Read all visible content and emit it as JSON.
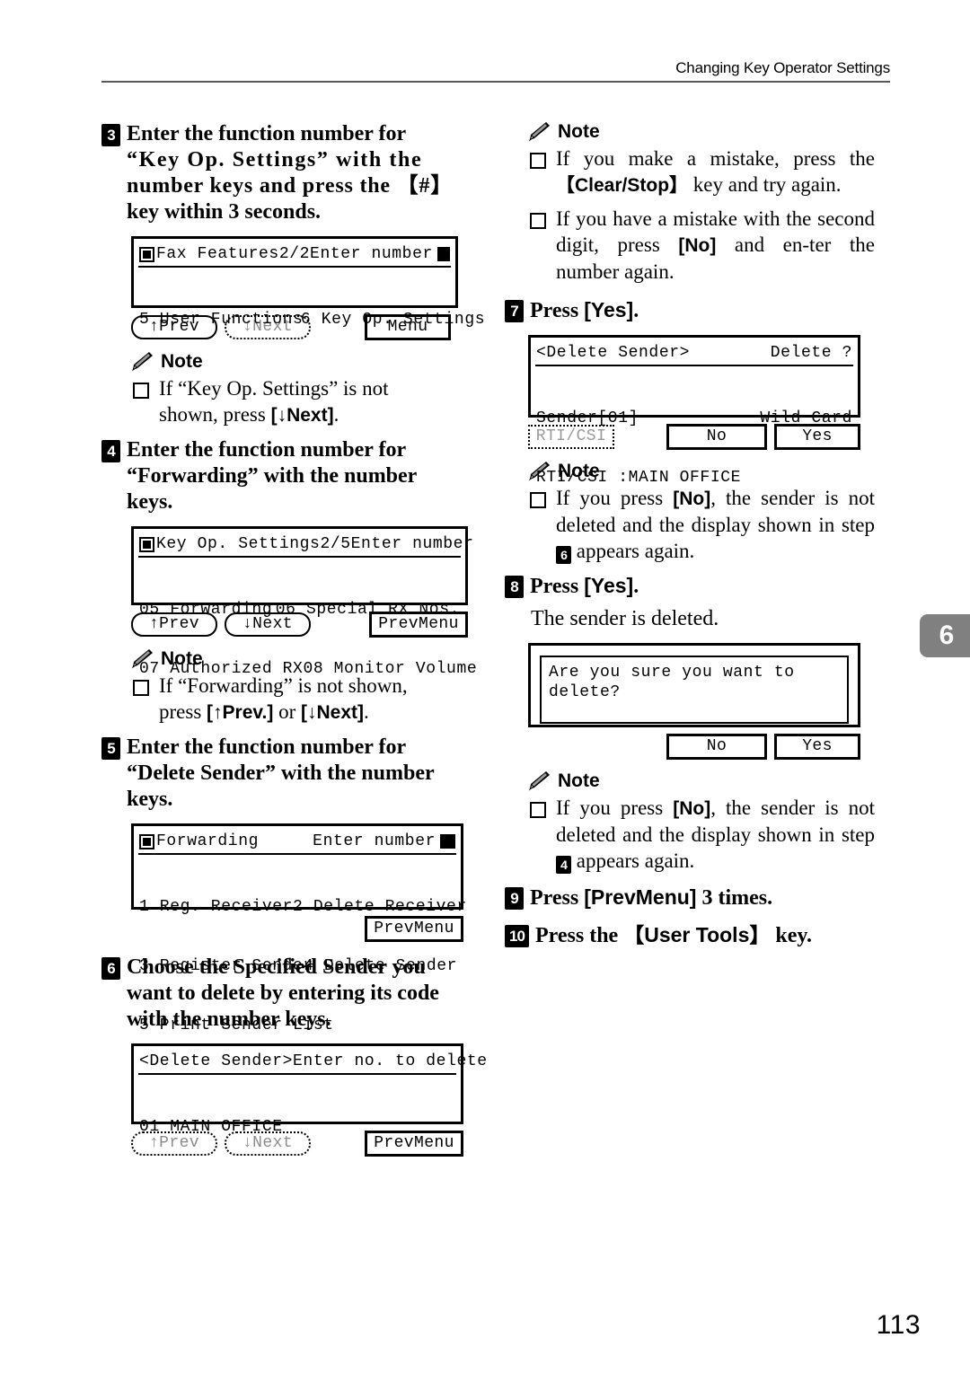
{
  "header": {
    "title": "Changing Key Operator Settings"
  },
  "chapter_tab": "6",
  "page_number": "113",
  "left_column": {
    "step3": {
      "badge": "3",
      "line1": "Enter  the  function  number  for",
      "line2": "“Key Op. Settings” with the",
      "line3": "number keys and press the 【#】",
      "line4": "key within 3 seconds."
    },
    "lcd1": {
      "title_left": "Fax Features",
      "title_mid": "2/2",
      "title_right": "Enter number",
      "row1_col1": "5 User Functions",
      "row1_col2": "6 Key Op. Settings",
      "btn_prev": "↑Prev",
      "btn_next": "↓Next",
      "btn_menu": "Menu"
    },
    "note1": {
      "label": "Note",
      "line1": "If  “Key  Op.  Settings”  is  not",
      "line2_pre": "shown, press ",
      "line2_key": "[↓Next]",
      "line2_post": "."
    },
    "step4": {
      "badge": "4",
      "line1": "Enter  the  function  number  for",
      "line2": "“Forwarding” with the number",
      "line3": "keys."
    },
    "lcd2": {
      "title_left": "Key Op. Settings",
      "title_mid": "2/5",
      "title_right": "Enter number",
      "row1_col1": "05 Forwarding",
      "row1_col2": "06 Special RX Nos.",
      "row2_col1": "07 Authorized RX",
      "row2_col2": "08 Monitor Volume",
      "btn_prev": "↑Prev",
      "btn_next": "↓Next",
      "btn_prevmenu": "PrevMenu"
    },
    "note2": {
      "label": "Note",
      "line1": "If  “Forwarding”  is  not  shown,",
      "line2_pre": "press ",
      "line2_key1": "[↑Prev.]",
      "line2_mid": " or ",
      "line2_key2": "[↓Next]",
      "line2_post": "."
    },
    "step5": {
      "badge": "5",
      "line1": "Enter  the  function  number  for",
      "line2": "“Delete Sender” with the number",
      "line3": "keys."
    },
    "lcd3": {
      "title_left": "Forwarding",
      "title_right": "Enter number",
      "row1_col1": "1 Reg. Receiver",
      "row1_col2": "2 Delete Receiver",
      "row2_col1": "3 Register Sender",
      "row2_col2": "4 Delete Sender",
      "row3_col1": "5 Print Sender List",
      "btn_prevmenu": "PrevMenu"
    },
    "step6": {
      "badge": "6",
      "line1": "Choose the Specified Sender you",
      "line2": "want to delete by entering its code",
      "line3": "with the number keys."
    },
    "lcd4": {
      "title_left": "<Delete Sender>",
      "title_right": "Enter no. to delete",
      "row1_col1": "01 MAIN OFFICE",
      "btn_prev": "↑Prev",
      "btn_next": "↓Next",
      "btn_prevmenu": "PrevMenu"
    }
  },
  "right_column": {
    "note3": {
      "label": "Note",
      "item1_pre": "If you make a mistake, press the",
      "item1_key": "【Clear/Stop】",
      "item1_post": " key and try again.",
      "item2_pre": "If  you  have  a  mistake  with  the second digit, press ",
      "item2_key": "[No]",
      "item2_post": " and en-ter the number again."
    },
    "step7": {
      "badge": "7",
      "text_pre": "Press ",
      "text_key": "[Yes]",
      "text_post": "."
    },
    "lcd5": {
      "title_left": "<Delete Sender>",
      "title_right": "Delete ?",
      "row1_col1": "Sender[01]",
      "row1_col2": "Wild Card",
      "row2_col1": "RTI/CSI :MAIN OFFICE",
      "btn_rticsi": "RTI/CSI",
      "btn_no": "No",
      "btn_yes": "Yes"
    },
    "note4": {
      "label": "Note",
      "item1_pre": "If you press ",
      "item1_key": "[No]",
      "item1_mid": ", the sender is not  deleted  and  the  display shown in step ",
      "item1_badge": "6",
      "item1_post": " appears again."
    },
    "step8": {
      "badge": "8",
      "text_pre": "Press ",
      "text_key": "[Yes]",
      "text_post": ".",
      "sub": "The sender is deleted."
    },
    "lcd6": {
      "message": "Are you sure you want to delete?",
      "btn_no": "No",
      "btn_yes": "Yes"
    },
    "note5": {
      "label": "Note",
      "item1_pre": "If you press ",
      "item1_key": "[No]",
      "item1_mid": ", the sender is not  deleted  and  the  display shown in step ",
      "item1_badge": "4",
      "item1_post": " appears again."
    },
    "step9": {
      "badge": "9",
      "text_pre": "Press ",
      "text_key": "[PrevMenu]",
      "text_post": " 3 times."
    },
    "step10": {
      "badge": "10",
      "text_pre": "Press the ",
      "text_key": "【User Tools】",
      "text_post": " key."
    }
  }
}
